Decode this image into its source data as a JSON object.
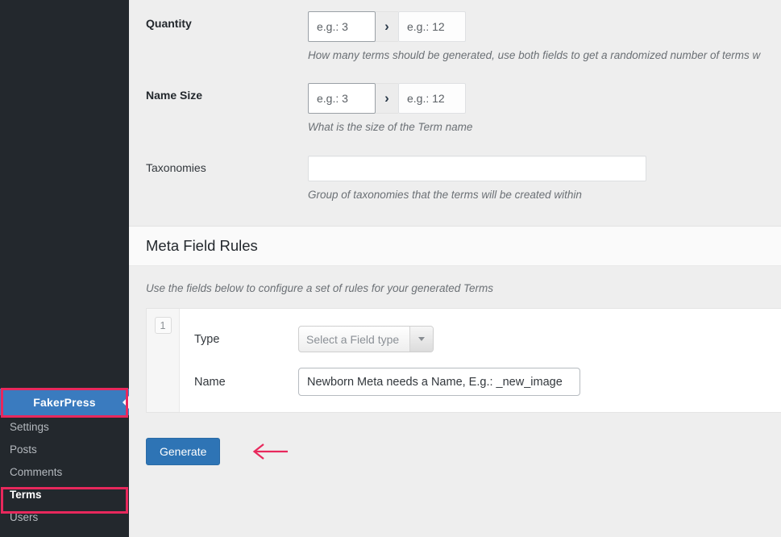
{
  "sidebar": {
    "brand": {
      "label": "FakerPress",
      "arrow_icon": "caret-left-icon"
    },
    "items": [
      {
        "label": "Settings",
        "current": false
      },
      {
        "label": "Posts",
        "current": false
      },
      {
        "label": "Comments",
        "current": false
      },
      {
        "label": "Terms",
        "current": true
      },
      {
        "label": "Users",
        "current": false
      }
    ]
  },
  "form": {
    "quantity": {
      "label": "Quantity",
      "min_placeholder": "e.g.: 3",
      "separator_icon": "chevron-right-icon",
      "max_placeholder": "e.g.: 12",
      "help": "How many terms should be generated, use both fields to get a randomized number of terms w"
    },
    "name_size": {
      "label": "Name Size",
      "min_placeholder": "e.g.: 3",
      "separator_icon": "chevron-right-icon",
      "max_placeholder": "e.g.: 12",
      "help": "What is the size of the Term name"
    },
    "taxonomies": {
      "label": "Taxonomies",
      "value": "",
      "placeholder": "",
      "help": "Group of taxonomies that the terms will be created within"
    }
  },
  "meta_field_rules": {
    "title": "Meta Field Rules",
    "note": "Use the fields below to configure a set of rules for your generated Terms",
    "rules": [
      {
        "index": "1",
        "type_label": "Type",
        "type_placeholder": "Select a Field type",
        "type_caret_icon": "caret-down-icon",
        "name_label": "Name",
        "name_placeholder": "Newborn Meta needs a Name, E.g.: _new_image",
        "name_value": ""
      }
    ]
  },
  "actions": {
    "generate_label": "Generate",
    "annotation_arrow_icon": "arrow-left-icon"
  },
  "colors": {
    "sidebar_bg": "#23282d",
    "brand_blue": "#3a7bbf",
    "button_blue": "#2e74b5",
    "annotation_pink": "#e8285c",
    "page_bg": "#eeeeee"
  }
}
